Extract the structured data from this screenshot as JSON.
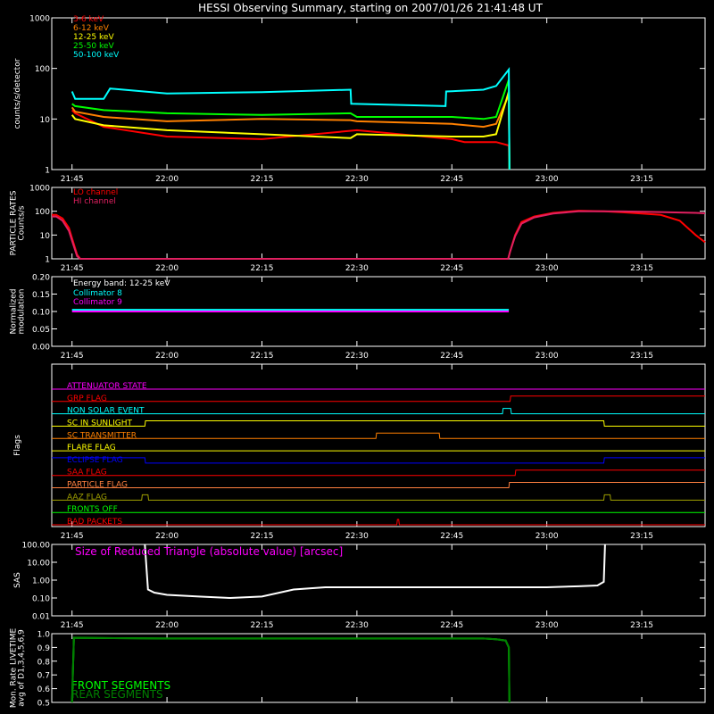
{
  "title": "HESSI Observing Summary, starting on 2007/01/26 21:41:48 UT",
  "time_ticks": [
    "21:45",
    "22:00",
    "22:15",
    "22:30",
    "22:45",
    "23:00",
    "23:15"
  ],
  "time_tick_minutes": [
    225,
    240,
    255,
    270,
    285,
    300,
    315
  ],
  "time_range_minutes": [
    221.8,
    325
  ],
  "colors": {
    "red": "#ff0000",
    "orange": "#ff8000",
    "yellow": "#ffff00",
    "green": "#00ff00",
    "cyan": "#00ffff",
    "magenta": "#ff00ff",
    "blue": "#0000ff",
    "olive": "#a0a000",
    "white": "#ffffff"
  },
  "chart_data": [
    {
      "type": "line",
      "panel": "count-rates",
      "ylabel": "counts/s/detector",
      "yscale": "log",
      "ylim": [
        1,
        1000
      ],
      "ytick_labels": [
        "1",
        "10",
        "100",
        "1000"
      ],
      "ytick_values": [
        1,
        10,
        100,
        1000
      ],
      "series": [
        {
          "name": "3-6 keV",
          "color": "#ff0000",
          "x": [
            225,
            225.5,
            230,
            240,
            255,
            270,
            285,
            287,
            290,
            292,
            294,
            294.1
          ],
          "y": [
            15,
            13,
            7,
            4.5,
            4,
            6,
            4,
            3.5,
            3.5,
            3.5,
            3,
            1
          ]
        },
        {
          "name": "6-12 keV",
          "color": "#ff8000",
          "x": [
            225,
            225.5,
            230,
            240,
            255,
            269,
            270,
            285,
            290,
            292,
            294,
            294.1
          ],
          "y": [
            17,
            14,
            11,
            9,
            10,
            9.5,
            9,
            8,
            7,
            8,
            30,
            1
          ]
        },
        {
          "name": "12-25 keV",
          "color": "#ffff00",
          "x": [
            225,
            225.5,
            230,
            240,
            255,
            269,
            270,
            285,
            290,
            292,
            294,
            294.1
          ],
          "y": [
            12,
            10,
            7.5,
            6,
            5,
            4.2,
            5,
            4.5,
            4.5,
            5,
            35,
            1
          ]
        },
        {
          "name": "25-50 keV",
          "color": "#00ff00",
          "x": [
            225,
            225.5,
            230,
            240,
            255,
            269,
            270,
            285,
            290,
            292,
            294,
            294.1
          ],
          "y": [
            20,
            18,
            15,
            13,
            12,
            13,
            11,
            11,
            10,
            11,
            60,
            1
          ]
        },
        {
          "name": "50-100 keV",
          "color": "#00ffff",
          "x": [
            225,
            225.5,
            230,
            231,
            240,
            255,
            269,
            269.1,
            284,
            284.1,
            290,
            292,
            294,
            294.1
          ],
          "y": [
            35,
            25,
            25,
            40,
            32,
            34,
            38,
            20,
            18,
            35,
            38,
            45,
            95,
            1
          ]
        }
      ]
    },
    {
      "type": "line",
      "panel": "particle-rates",
      "ylabel": "PARTICLE RATES Counts/s",
      "yscale": "log",
      "ylim": [
        1,
        1000
      ],
      "ytick_labels": [
        "1",
        "10",
        "100",
        "1000"
      ],
      "ytick_values": [
        1,
        10,
        100,
        1000
      ],
      "series": [
        {
          "name": "LO channel",
          "color": "#ff0000",
          "x": [
            221.8,
            222.5,
            223.5,
            224.5,
            225.2,
            225.8,
            226.3,
            293.9,
            294.2,
            295,
            296,
            298,
            301,
            305,
            309,
            312,
            315,
            318,
            321,
            323.5,
            325
          ],
          "y": [
            70,
            70,
            50,
            20,
            5,
            1.5,
            1,
            1,
            2,
            10,
            35,
            60,
            85,
            105,
            100,
            90,
            80,
            70,
            40,
            10,
            5
          ]
        },
        {
          "name": "HI channel",
          "color": "#e02060",
          "x": [
            221.8,
            222.5,
            223.5,
            224.5,
            225.2,
            225.8,
            226.3,
            293.9,
            294.2,
            295,
            296,
            298,
            301,
            305,
            309,
            312,
            315,
            318,
            321,
            323.5,
            325
          ],
          "y": [
            60,
            60,
            40,
            15,
            4,
            1.3,
            1,
            1,
            2,
            9,
            30,
            55,
            80,
            100,
            100,
            98,
            95,
            92,
            88,
            85,
            82
          ]
        }
      ]
    },
    {
      "type": "line",
      "panel": "modulation",
      "ylabel": "Normalized modulation",
      "ylim": [
        0,
        0.2
      ],
      "ytick_labels": [
        "0.00",
        "0.05",
        "0.10",
        "0.15",
        "0.20"
      ],
      "ytick_values": [
        0,
        0.05,
        0.1,
        0.15,
        0.2
      ],
      "annotation": "Energy band: 12-25 keV",
      "series": [
        {
          "name": "Collimator 8",
          "color": "#00ffff",
          "x": [
            225,
            294
          ],
          "y": [
            0.105,
            0.105
          ]
        },
        {
          "name": "Collimator 9",
          "color": "#ff00ff",
          "x": [
            225,
            294
          ],
          "y": [
            0.1,
            0.1
          ]
        }
      ]
    },
    {
      "type": "line",
      "panel": "flags",
      "ylabel": "Flags",
      "series": [
        {
          "name": "ATTENUATOR STATE",
          "color": "#ff00ff",
          "x": [
            221.8,
            325
          ],
          "y": [
            0,
            0
          ]
        },
        {
          "name": "GRP FLAG",
          "color": "#ff0000",
          "x": [
            221.8,
            294.2,
            294.3,
            325
          ],
          "y": [
            0,
            0,
            1,
            1
          ]
        },
        {
          "name": "NON SOLAR EVENT",
          "color": "#00ffff",
          "x": [
            221.8,
            293,
            293.1,
            294.3,
            294.4,
            325
          ],
          "y": [
            0,
            0,
            1,
            1,
            0,
            0
          ]
        },
        {
          "name": "SC IN SUNLIGHT",
          "color": "#ffff00",
          "x": [
            221.8,
            236.5,
            236.6,
            309,
            309.1,
            325
          ],
          "y": [
            0,
            0,
            1,
            1,
            0,
            0
          ]
        },
        {
          "name": "SC TRANSMITTER",
          "color": "#ff8000",
          "x": [
            221.8,
            273,
            273.1,
            283,
            283.1,
            325
          ],
          "y": [
            0,
            0,
            1,
            1,
            0,
            0
          ]
        },
        {
          "name": "FLARE FLAG",
          "color": "#ffff00",
          "x": [
            221.8,
            325
          ],
          "y": [
            0,
            0
          ]
        },
        {
          "name": "ECLIPSE FLAG",
          "color": "#0000ff",
          "x": [
            221.8,
            236.5,
            236.6,
            309,
            309.1,
            325
          ],
          "y": [
            1,
            1,
            0,
            0,
            1,
            1
          ]
        },
        {
          "name": "SAA FLAG",
          "color": "#ff0000",
          "x": [
            221.8,
            295,
            295.1,
            325
          ],
          "y": [
            0,
            0,
            1,
            1
          ]
        },
        {
          "name": "PARTICLE FLAG",
          "color": "#ff8040",
          "x": [
            221.8,
            294,
            294.1,
            325
          ],
          "y": [
            0,
            0,
            1,
            1
          ]
        },
        {
          "name": "AAZ FLAG",
          "color": "#a0a000",
          "x": [
            221.8,
            236,
            236.1,
            237,
            237.1,
            309,
            309.1,
            310,
            310.1,
            325
          ],
          "y": [
            0,
            0,
            1,
            1,
            0,
            0,
            1,
            1,
            0,
            0
          ]
        },
        {
          "name": "FRONTS OFF",
          "color": "#00ff00",
          "x": [
            221.8,
            325
          ],
          "y": [
            0,
            0
          ]
        },
        {
          "name": "BAD PACKETS",
          "color": "#ff0000",
          "x": [
            221.8,
            276.3,
            276.4,
            276.6,
            276.7,
            325
          ],
          "y": [
            0,
            0,
            1,
            1,
            0,
            0
          ]
        }
      ]
    },
    {
      "type": "line",
      "panel": "sas",
      "ylabel": "SAS",
      "yscale": "log",
      "ylim": [
        0.01,
        100
      ],
      "ytick_labels": [
        "0.01",
        "0.10",
        "1.00",
        "10.00",
        "100.00"
      ],
      "ytick_values": [
        0.01,
        0.1,
        1,
        10,
        100
      ],
      "annotation": "Size of Reduced Triangle (absolute value) [arcsec]",
      "series": [
        {
          "name": "",
          "color": "#ffffff",
          "x": [
            236.5,
            237,
            238,
            240,
            245,
            250,
            255,
            260,
            265,
            270,
            280,
            290,
            300,
            305,
            308,
            309,
            309.2
          ],
          "y": [
            100,
            0.3,
            0.2,
            0.15,
            0.12,
            0.1,
            0.12,
            0.3,
            0.4,
            0.4,
            0.4,
            0.4,
            0.4,
            0.45,
            0.5,
            0.8,
            100
          ]
        }
      ]
    },
    {
      "type": "line",
      "panel": "livetime",
      "ylabel": "Mon. Rate LIVETIME avg of D1,3,4,5,6,9",
      "ylim": [
        0.5,
        1.0
      ],
      "ytick_labels": [
        "0.5",
        "0.6",
        "0.7",
        "0.8",
        "0.9",
        "1.0"
      ],
      "ytick_values": [
        0.5,
        0.6,
        0.7,
        0.8,
        0.9,
        1.0
      ],
      "series": [
        {
          "name": "FRONT SEGMENTS",
          "color": "#00ff00",
          "x": [
            225,
            225.3,
            240,
            260,
            280,
            290,
            292,
            293.5,
            294,
            294.1
          ],
          "y": [
            0.5,
            0.97,
            0.965,
            0.965,
            0.965,
            0.965,
            0.96,
            0.95,
            0.9,
            0.5
          ]
        },
        {
          "name": "REAR SEGMENTS",
          "color": "#008000",
          "x": [
            225,
            225.3,
            240,
            260,
            280,
            290,
            292,
            293.5,
            294,
            294.1
          ],
          "y": [
            0.5,
            0.97,
            0.965,
            0.965,
            0.965,
            0.965,
            0.96,
            0.95,
            0.9,
            0.5
          ]
        }
      ]
    }
  ]
}
